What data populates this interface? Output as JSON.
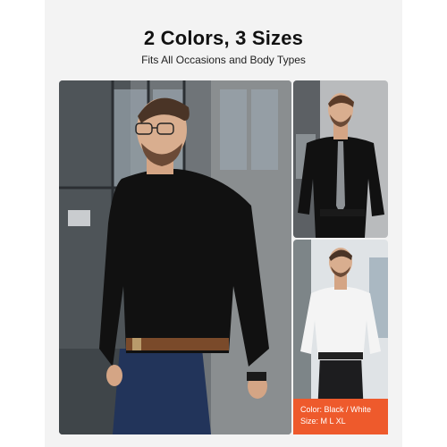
{
  "header": {
    "title": "2 Colors, 3 Sizes",
    "subtitle": "Fits All Occasions and Body Types"
  },
  "badge": {
    "color_line": "Color: Black / White",
    "size_line": "Size: M L XL",
    "background": "#ee5a2c"
  },
  "photos": {
    "main": "man in black shirt, navy trousers, brown belt, glasses, city street",
    "top_right": "man in black shirt with grey tie",
    "bottom_right": "man in white shirt with black trousers"
  },
  "colors": {
    "page_bg": "#f3f3f3",
    "shirt_black": "#111111",
    "shirt_white": "#f4f4f4",
    "trousers_navy": "#22345a",
    "belt_brown": "#7a4a2a"
  }
}
